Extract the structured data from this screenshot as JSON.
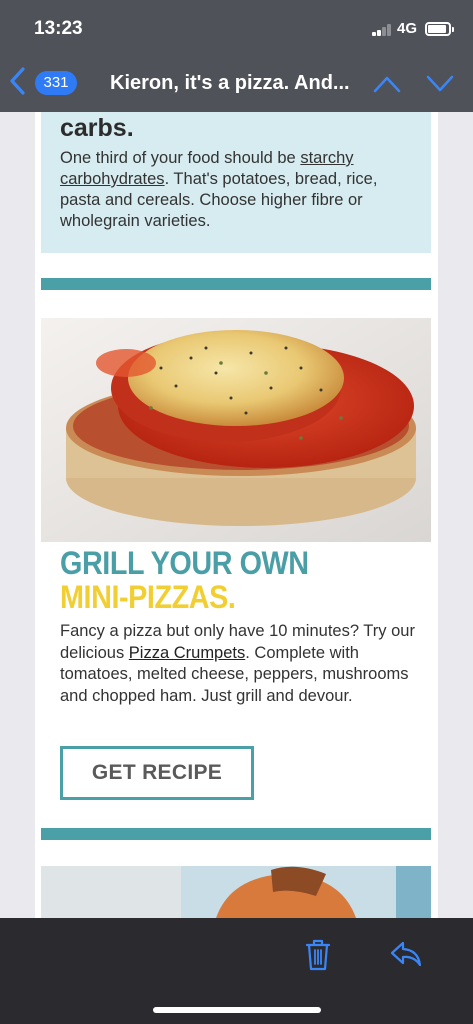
{
  "status": {
    "time": "13:23",
    "network": "4G"
  },
  "nav": {
    "unread_count": "331",
    "subject": "Kieron, it's a pizza. And..."
  },
  "carbs": {
    "heading": "carbs.",
    "text_before": "One third of your food should be ",
    "link": "starchy carbohydrates",
    "text_after": ". That's potatoes, bread, rice, pasta and cereals. Choose higher fibre or wholegrain varieties."
  },
  "pizza": {
    "heading_line1": "GRILL YOUR OWN",
    "heading_line2": "MINI-PIZZAS.",
    "text_before": "Fancy a pizza but only have 10 minutes? Try our delicious ",
    "link": "Pizza Crumpets",
    "text_after": ". Complete with tomatoes, melted cheese, peppers, mushrooms and chopped ham. Just grill and devour.",
    "button_label": "GET RECIPE"
  },
  "colors": {
    "accent_teal": "#4aa0a6",
    "accent_yellow": "#f1cf33",
    "ios_blue": "#2f7bf6",
    "light_teal_box": "#d6ecf0"
  },
  "icons": [
    "back-chevron-icon",
    "chevron-up-icon",
    "chevron-down-icon",
    "trash-icon",
    "reply-icon",
    "signal-icon",
    "battery-icon"
  ]
}
